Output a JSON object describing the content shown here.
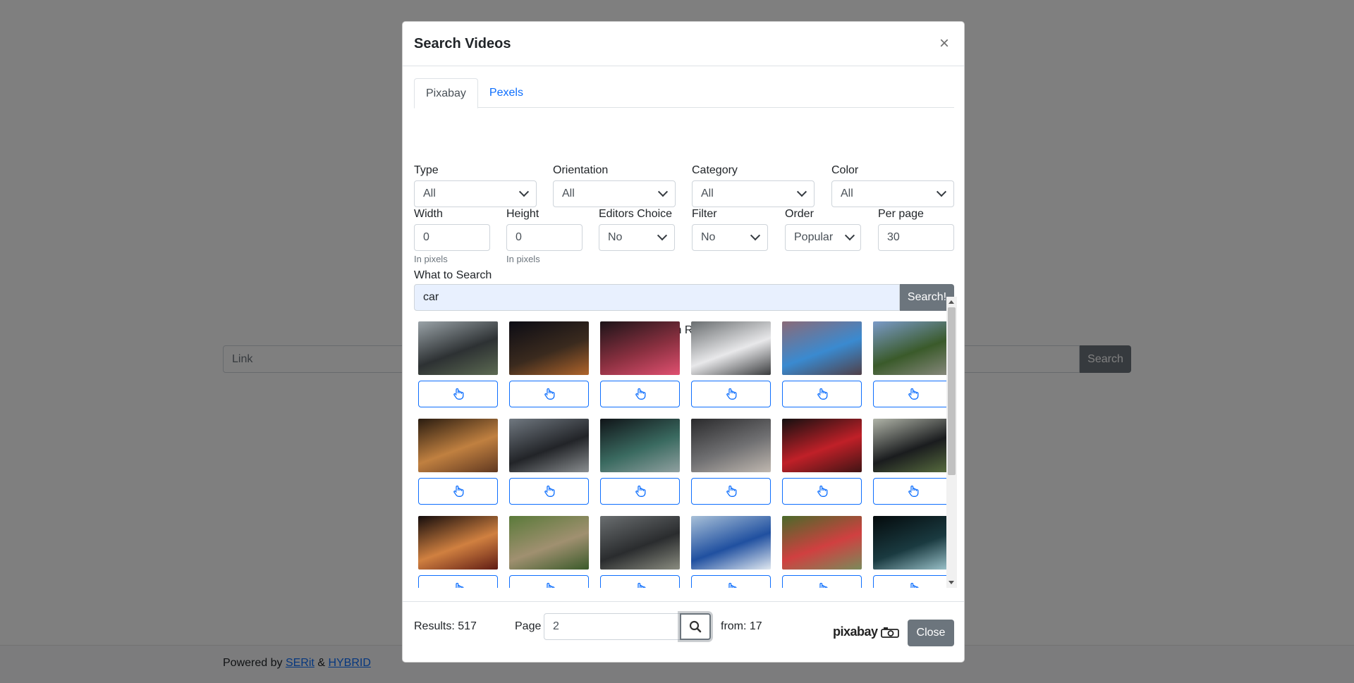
{
  "background": {
    "link_placeholder": "Link",
    "search_label": "Search",
    "footer": {
      "powered_by": "Powered by",
      "link1": "SERit",
      "amp": "&",
      "link2": "HYBRID"
    }
  },
  "modal": {
    "title": "Search Videos",
    "close_symbol": "×",
    "tabs": [
      {
        "label": "Pixabay",
        "active": true
      },
      {
        "label": "Pexels",
        "active": false
      }
    ],
    "filters": {
      "type": {
        "label": "Type",
        "value": "All"
      },
      "orientation": {
        "label": "Orientation",
        "value": "All"
      },
      "category": {
        "label": "Category",
        "value": "All"
      },
      "color": {
        "label": "Color",
        "value": "All"
      },
      "width": {
        "label": "Width",
        "value": "0",
        "help": "In pixels"
      },
      "height": {
        "label": "Height",
        "value": "0",
        "help": "In pixels"
      },
      "editors_choice": {
        "label": "Editors Choice",
        "value": "No"
      },
      "filter": {
        "label": "Filter",
        "value": "No"
      },
      "order": {
        "label": "Order",
        "value": "Popular"
      },
      "per_page": {
        "label": "Per page",
        "value": "30"
      }
    },
    "search": {
      "label": "What to Search",
      "value": "car",
      "button": "Search!"
    },
    "results_title": "Search Results",
    "results": [
      {
        "colors": [
          "#9aa3a8",
          "#2d3133",
          "#5c6a52"
        ]
      },
      {
        "colors": [
          "#0c0c14",
          "#3a2a1e",
          "#b0642a"
        ]
      },
      {
        "colors": [
          "#1c1418",
          "#8a3040",
          "#e05070"
        ]
      },
      {
        "colors": [
          "#6a6e70",
          "#e8e8ea",
          "#3a3c3e"
        ]
      },
      {
        "colors": [
          "#8a6a78",
          "#3a8ad0",
          "#504048"
        ]
      },
      {
        "colors": [
          "#7a9ac8",
          "#3a5a2a",
          "#8a8a80"
        ]
      },
      {
        "colors": [
          "#2a1c10",
          "#c08040",
          "#603820"
        ]
      },
      {
        "colors": [
          "#707880",
          "#222428",
          "#8a8e90"
        ]
      },
      {
        "colors": [
          "#101418",
          "#3a6a60",
          "#90a0a0"
        ]
      },
      {
        "colors": [
          "#2a2a2c",
          "#707072",
          "#c0b8b0"
        ]
      },
      {
        "colors": [
          "#141010",
          "#c02028",
          "#401414"
        ]
      },
      {
        "colors": [
          "#b0b4a8",
          "#1a1c1e",
          "#5a7040"
        ]
      },
      {
        "colors": [
          "#140c0c",
          "#d08040",
          "#601c14"
        ]
      },
      {
        "colors": [
          "#5a7a3a",
          "#a09070",
          "#3a5a2a"
        ]
      },
      {
        "colors": [
          "#6a6e70",
          "#2a2c2e",
          "#8a8c80"
        ]
      },
      {
        "colors": [
          "#a8c0d8",
          "#2050a0",
          "#e0e8f0"
        ]
      },
      {
        "colors": [
          "#4a6a2a",
          "#d04040",
          "#7a8a5a"
        ]
      },
      {
        "colors": [
          "#040a0c",
          "#1a3a40",
          "#a0c8d0"
        ]
      }
    ],
    "footer": {
      "results_text": "Results: 517",
      "page_label": "Page",
      "page_value": "2",
      "from_text": "from: 17",
      "logo_text": "pixabay",
      "close_label": "Close"
    }
  }
}
